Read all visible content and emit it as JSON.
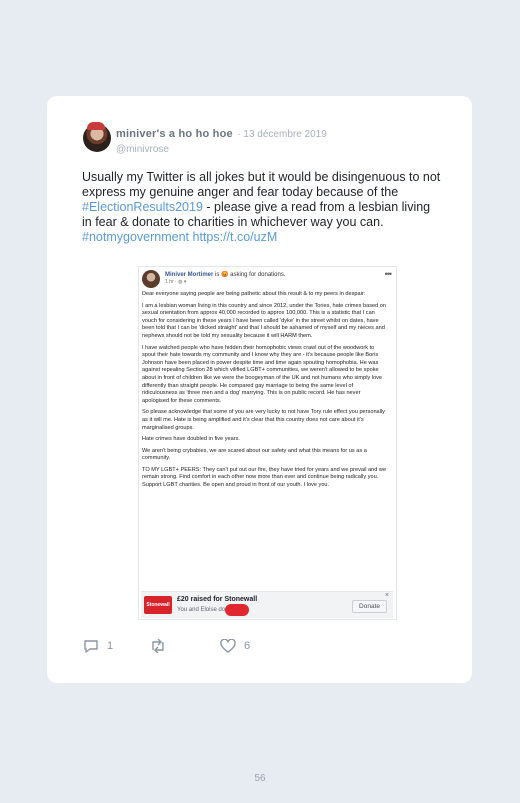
{
  "tweet": {
    "author_name": "miniver's a ho ho hoe",
    "date": "· 13 décembre 2019",
    "handle": "@minivrose",
    "text_part1": "Usually my Twitter is all jokes but it would be disingenuous to not express my genuine anger and fear today because of the ",
    "hashtag1": "#ElectionResults2019",
    "text_part2": " - please give a read from a lesbian living in fear & donate to charities in whichever way you can. ",
    "hashtag2": "#notmygovernment",
    "link": "https://t.co/uzM",
    "reply_count": "1",
    "like_count": "6"
  },
  "fb_post": {
    "author": "Miniver Mortimer",
    "status": "is 😡 asking for donations.",
    "time": "1 hr · ",
    "paragraphs": [
      "Dear everyone saying people are being pathetic about this result & to my peers in despair:",
      "I am a lesbian woman living in this country and since 2012, under the Tories, hate crimes based on sexual orientation from approx 40,000 recorded to approx 100,000. This is a statistic that I can vouch for considering in these years I have been called 'dyke' in the street whilst on dates, have been told that I can be 'dicked straight' and that I should be ashamed of myself and my nieces and nephews should not be told my sexuality because it will HARM them.",
      "I have watched people who have hidden their homophobic views crawl out of the woodwork to spout their hate towards my community and I know why they are - it's because people like Boris Johnson have been placed in power despite time and time again spouting homophobia. He was against repealing Section 28 which vilified LGBT+ communities, we weren't allowed to be spoke about in front of children like we were the boogeyman of the UK and not humans who simply love differently than straight people. He compared gay marriage to being the same level of ridiculousness as 'three men and a dog' marrying. This is on public record. He has never apologised for these comments.",
      "So please acknowledge that some of you are very lucky to not have Tory rule effect you personally as it will me. Hate is being amplified and it's clear that this country does not care about it's marginalised groups.",
      "Hate crimes have doubled in five years.",
      "We aren't being crybabies, we are scared about our safety and what this means for us as a community.",
      "TO MY LGBT+ PEERS: They can't put out our fire, they have tried for years and we prevail and we remain strong. Find comfort in each other now more than ever and continue being radically you. Support LGBT charities. Be open and proud in front of our youth. I love you."
    ],
    "donation": {
      "logo": "Stonewall",
      "title": "£20 raised for Stonewall",
      "subtitle": "You and Eloise                  donated.",
      "button": "Donate",
      "close": "×"
    }
  },
  "page_number": "56"
}
